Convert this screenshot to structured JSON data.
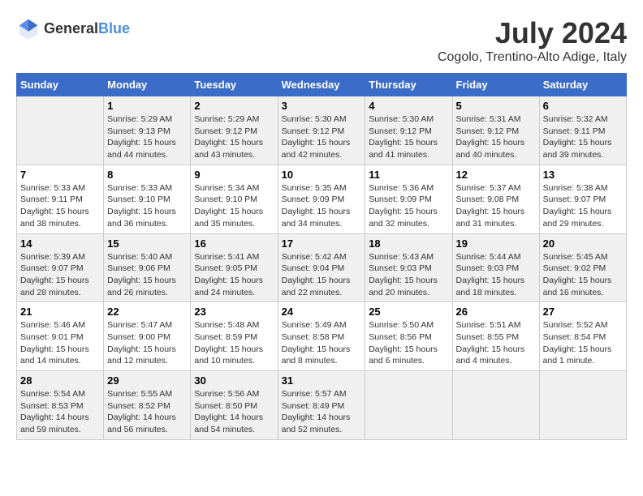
{
  "logo": {
    "text_general": "General",
    "text_blue": "Blue"
  },
  "title": {
    "month_year": "July 2024",
    "location": "Cogolo, Trentino-Alto Adige, Italy"
  },
  "weekdays": [
    "Sunday",
    "Monday",
    "Tuesday",
    "Wednesday",
    "Thursday",
    "Friday",
    "Saturday"
  ],
  "weeks": [
    [
      {
        "day": "",
        "sunrise": "",
        "sunset": "",
        "daylight": ""
      },
      {
        "day": "1",
        "sunrise": "Sunrise: 5:29 AM",
        "sunset": "Sunset: 9:13 PM",
        "daylight": "Daylight: 15 hours and 44 minutes."
      },
      {
        "day": "2",
        "sunrise": "Sunrise: 5:29 AM",
        "sunset": "Sunset: 9:12 PM",
        "daylight": "Daylight: 15 hours and 43 minutes."
      },
      {
        "day": "3",
        "sunrise": "Sunrise: 5:30 AM",
        "sunset": "Sunset: 9:12 PM",
        "daylight": "Daylight: 15 hours and 42 minutes."
      },
      {
        "day": "4",
        "sunrise": "Sunrise: 5:30 AM",
        "sunset": "Sunset: 9:12 PM",
        "daylight": "Daylight: 15 hours and 41 minutes."
      },
      {
        "day": "5",
        "sunrise": "Sunrise: 5:31 AM",
        "sunset": "Sunset: 9:12 PM",
        "daylight": "Daylight: 15 hours and 40 minutes."
      },
      {
        "day": "6",
        "sunrise": "Sunrise: 5:32 AM",
        "sunset": "Sunset: 9:11 PM",
        "daylight": "Daylight: 15 hours and 39 minutes."
      }
    ],
    [
      {
        "day": "7",
        "sunrise": "Sunrise: 5:33 AM",
        "sunset": "Sunset: 9:11 PM",
        "daylight": "Daylight: 15 hours and 38 minutes."
      },
      {
        "day": "8",
        "sunrise": "Sunrise: 5:33 AM",
        "sunset": "Sunset: 9:10 PM",
        "daylight": "Daylight: 15 hours and 36 minutes."
      },
      {
        "day": "9",
        "sunrise": "Sunrise: 5:34 AM",
        "sunset": "Sunset: 9:10 PM",
        "daylight": "Daylight: 15 hours and 35 minutes."
      },
      {
        "day": "10",
        "sunrise": "Sunrise: 5:35 AM",
        "sunset": "Sunset: 9:09 PM",
        "daylight": "Daylight: 15 hours and 34 minutes."
      },
      {
        "day": "11",
        "sunrise": "Sunrise: 5:36 AM",
        "sunset": "Sunset: 9:09 PM",
        "daylight": "Daylight: 15 hours and 32 minutes."
      },
      {
        "day": "12",
        "sunrise": "Sunrise: 5:37 AM",
        "sunset": "Sunset: 9:08 PM",
        "daylight": "Daylight: 15 hours and 31 minutes."
      },
      {
        "day": "13",
        "sunrise": "Sunrise: 5:38 AM",
        "sunset": "Sunset: 9:07 PM",
        "daylight": "Daylight: 15 hours and 29 minutes."
      }
    ],
    [
      {
        "day": "14",
        "sunrise": "Sunrise: 5:39 AM",
        "sunset": "Sunset: 9:07 PM",
        "daylight": "Daylight: 15 hours and 28 minutes."
      },
      {
        "day": "15",
        "sunrise": "Sunrise: 5:40 AM",
        "sunset": "Sunset: 9:06 PM",
        "daylight": "Daylight: 15 hours and 26 minutes."
      },
      {
        "day": "16",
        "sunrise": "Sunrise: 5:41 AM",
        "sunset": "Sunset: 9:05 PM",
        "daylight": "Daylight: 15 hours and 24 minutes."
      },
      {
        "day": "17",
        "sunrise": "Sunrise: 5:42 AM",
        "sunset": "Sunset: 9:04 PM",
        "daylight": "Daylight: 15 hours and 22 minutes."
      },
      {
        "day": "18",
        "sunrise": "Sunrise: 5:43 AM",
        "sunset": "Sunset: 9:03 PM",
        "daylight": "Daylight: 15 hours and 20 minutes."
      },
      {
        "day": "19",
        "sunrise": "Sunrise: 5:44 AM",
        "sunset": "Sunset: 9:03 PM",
        "daylight": "Daylight: 15 hours and 18 minutes."
      },
      {
        "day": "20",
        "sunrise": "Sunrise: 5:45 AM",
        "sunset": "Sunset: 9:02 PM",
        "daylight": "Daylight: 15 hours and 16 minutes."
      }
    ],
    [
      {
        "day": "21",
        "sunrise": "Sunrise: 5:46 AM",
        "sunset": "Sunset: 9:01 PM",
        "daylight": "Daylight: 15 hours and 14 minutes."
      },
      {
        "day": "22",
        "sunrise": "Sunrise: 5:47 AM",
        "sunset": "Sunset: 9:00 PM",
        "daylight": "Daylight: 15 hours and 12 minutes."
      },
      {
        "day": "23",
        "sunrise": "Sunrise: 5:48 AM",
        "sunset": "Sunset: 8:59 PM",
        "daylight": "Daylight: 15 hours and 10 minutes."
      },
      {
        "day": "24",
        "sunrise": "Sunrise: 5:49 AM",
        "sunset": "Sunset: 8:58 PM",
        "daylight": "Daylight: 15 hours and 8 minutes."
      },
      {
        "day": "25",
        "sunrise": "Sunrise: 5:50 AM",
        "sunset": "Sunset: 8:56 PM",
        "daylight": "Daylight: 15 hours and 6 minutes."
      },
      {
        "day": "26",
        "sunrise": "Sunrise: 5:51 AM",
        "sunset": "Sunset: 8:55 PM",
        "daylight": "Daylight: 15 hours and 4 minutes."
      },
      {
        "day": "27",
        "sunrise": "Sunrise: 5:52 AM",
        "sunset": "Sunset: 8:54 PM",
        "daylight": "Daylight: 15 hours and 1 minute."
      }
    ],
    [
      {
        "day": "28",
        "sunrise": "Sunrise: 5:54 AM",
        "sunset": "Sunset: 8:53 PM",
        "daylight": "Daylight: 14 hours and 59 minutes."
      },
      {
        "day": "29",
        "sunrise": "Sunrise: 5:55 AM",
        "sunset": "Sunset: 8:52 PM",
        "daylight": "Daylight: 14 hours and 56 minutes."
      },
      {
        "day": "30",
        "sunrise": "Sunrise: 5:56 AM",
        "sunset": "Sunset: 8:50 PM",
        "daylight": "Daylight: 14 hours and 54 minutes."
      },
      {
        "day": "31",
        "sunrise": "Sunrise: 5:57 AM",
        "sunset": "Sunset: 8:49 PM",
        "daylight": "Daylight: 14 hours and 52 minutes."
      },
      {
        "day": "",
        "sunrise": "",
        "sunset": "",
        "daylight": ""
      },
      {
        "day": "",
        "sunrise": "",
        "sunset": "",
        "daylight": ""
      },
      {
        "day": "",
        "sunrise": "",
        "sunset": "",
        "daylight": ""
      }
    ]
  ]
}
